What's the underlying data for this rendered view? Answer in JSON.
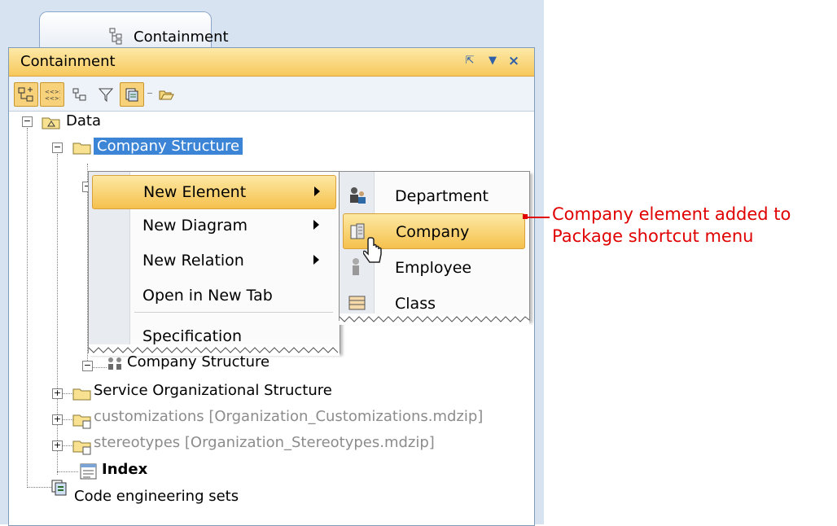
{
  "tab": {
    "label": "Containment",
    "icon": "tree-icon"
  },
  "panel": {
    "title": "Containment",
    "controls": [
      "restore-icon",
      "pin-icon",
      "close-icon"
    ]
  },
  "toolbar": {
    "buttons": [
      {
        "icon": "expand-tree-icon",
        "active": true
      },
      {
        "icon": "group-icon",
        "active": true
      },
      {
        "icon": "containment-icon",
        "active": false
      },
      {
        "icon": "filter-icon",
        "active": false
      },
      {
        "icon": "code-sets-icon",
        "active": true
      },
      {
        "icon": "open-folder-icon",
        "active": false
      }
    ]
  },
  "tree": {
    "root": "Data",
    "company_structure": "Company Structure",
    "company_structure_diagram": "Company Structure",
    "service_org": "Service Organizational Structure",
    "customizations": "customizations [Organization_Customizations.mdzip]",
    "stereotypes": "stereotypes [Organization_Stereotypes.mdzip]",
    "index": "Index",
    "code_sets": "Code engineering sets"
  },
  "context_menu": {
    "items": [
      {
        "label": "New Element",
        "submenu": true,
        "highlighted": true
      },
      {
        "label": "New Diagram",
        "submenu": true
      },
      {
        "label": "New Relation",
        "submenu": true
      },
      {
        "label": "Open in New Tab",
        "submenu": false
      },
      {
        "label": "Specification",
        "submenu": false
      }
    ]
  },
  "submenu": {
    "items": [
      {
        "label": "Department",
        "icon": "department-icon"
      },
      {
        "label": "Company",
        "icon": "company-icon",
        "highlighted": true
      },
      {
        "label": "Employee",
        "icon": "employee-icon"
      },
      {
        "label": "Class",
        "icon": "class-icon"
      }
    ]
  },
  "annotation": {
    "line1": "Company element added to",
    "line2": "Package shortcut menu",
    "color": "#e00000"
  },
  "colors": {
    "selection": "#3b84d6",
    "highlight": "#f5c14d",
    "frame": "#d7e3f1"
  }
}
